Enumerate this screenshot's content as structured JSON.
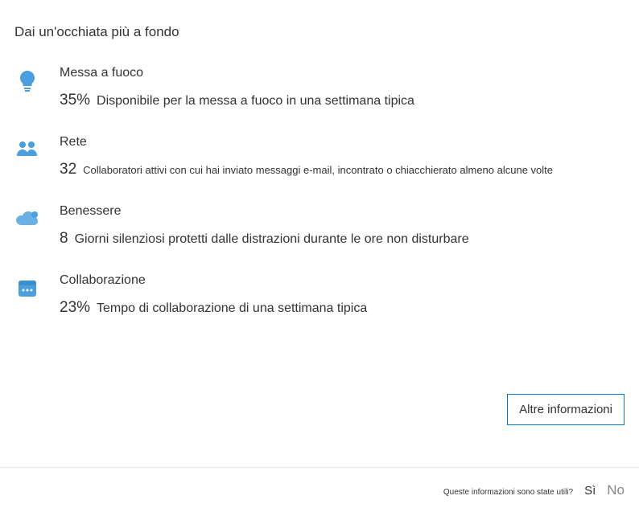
{
  "section_title": "Dai un'occhiata più a fondo",
  "insights": [
    {
      "label": "Messa a fuoco",
      "value": "35%",
      "description": "Disponibile per la messa a fuoco in una settimana tipica",
      "icon": "lightbulb"
    },
    {
      "label": "Rete",
      "value": "32",
      "description": "Collaboratori attivi con cui hai inviato messaggi e-mail, incontrato o chiacchierato almeno alcune volte",
      "icon": "people"
    },
    {
      "label": "Benessere",
      "value": "8",
      "description": "Giorni silenziosi protetti dalle distrazioni durante le ore non disturbare",
      "icon": "cloud"
    },
    {
      "label": "Collaborazione",
      "value": "23%",
      "description": "Tempo di collaborazione di una settimana tipica",
      "icon": "calendar"
    }
  ],
  "more_info_button": "Altre informazioni",
  "footer": {
    "question": "Queste informazioni sono state utili?",
    "yes": "Sì",
    "no": "No"
  }
}
